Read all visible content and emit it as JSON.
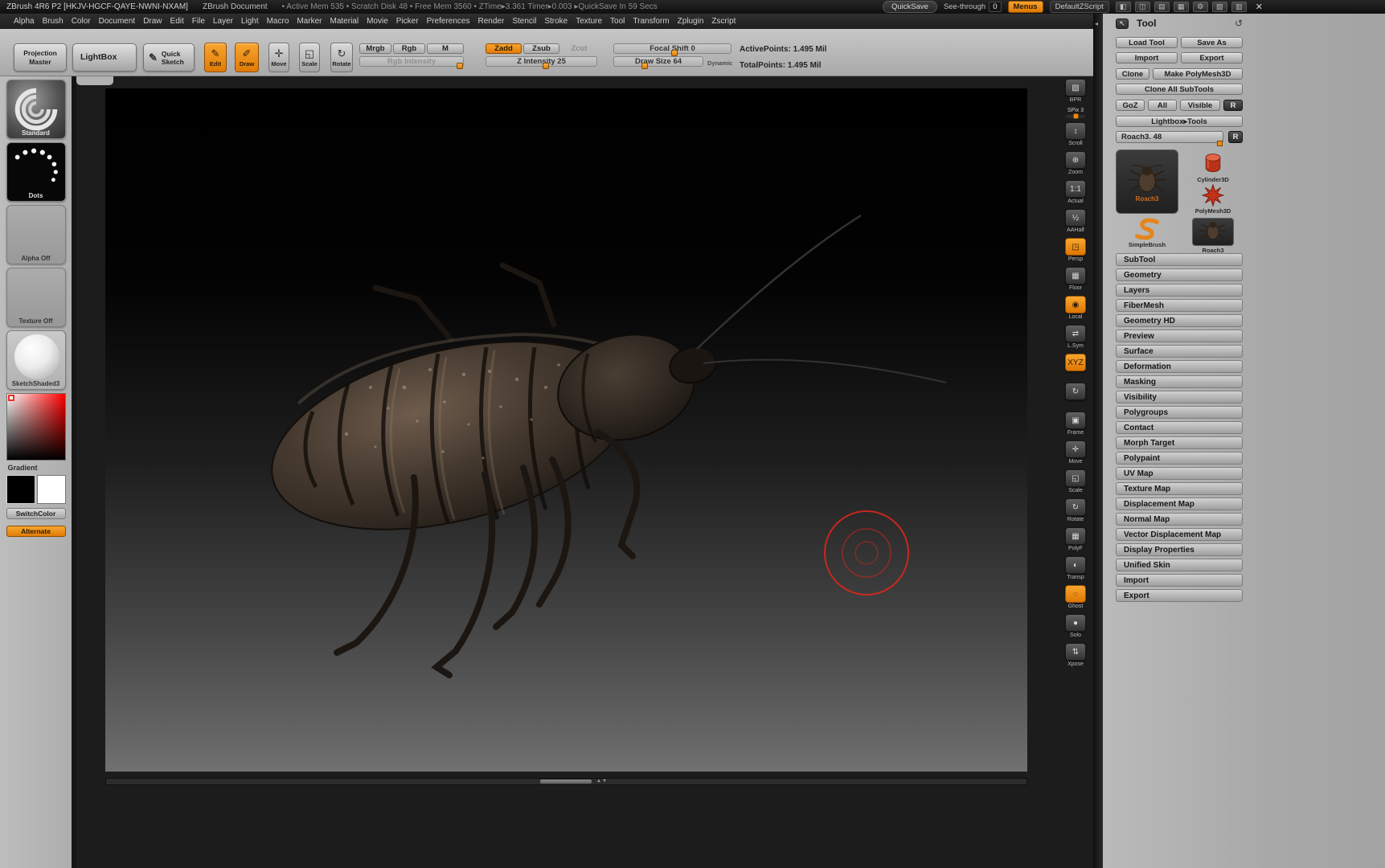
{
  "colors": {
    "accent": "#ed8a0e",
    "ui_gray": "#b5b5b5",
    "canvas_dark": "#1c1c1c"
  },
  "title_bar": {
    "app_title": "ZBrush 4R6 P2 [HKJV-HGCF-QAYE-NWNI-NXAM]",
    "document_title": "ZBrush Document",
    "stats": "• Active Mem 535  • Scratch Disk 48  • Free Mem 3560  • ZTime▸3.361  Timer▸0.003  ▸QuickSave In 59 Secs",
    "quicksave_label": "QuickSave",
    "see_through_label": "See-through",
    "see_through_value": "0",
    "menus_label": "Menus",
    "zscript_label": "DefaultZScript",
    "window_icons": [
      "◧",
      "◫",
      "▤",
      "▦",
      "⚙",
      "▧",
      "▥"
    ],
    "close_icon": "✕"
  },
  "menu_bar": {
    "items": [
      "Alpha",
      "Brush",
      "Color",
      "Document",
      "Draw",
      "Edit",
      "File",
      "Layer",
      "Light",
      "Macro",
      "Marker",
      "Material",
      "Movie",
      "Picker",
      "Preferences",
      "Render",
      "Stencil",
      "Stroke",
      "Texture",
      "Tool",
      "Transform",
      "Zplugin",
      "Zscript"
    ]
  },
  "top_shelf": {
    "projection_master": "Projection Master",
    "lightbox": "LightBox",
    "quick_sketch": "Quick Sketch",
    "quick_sketch_icon": "✎",
    "edit": "Edit",
    "edit_icon": "✎",
    "draw": "Draw",
    "draw_icon": "✐",
    "move": "Move",
    "move_icon": "✛",
    "scale": "Scale",
    "scale_icon": "◱",
    "rotate": "Rotate",
    "rotate_icon": "↻",
    "mrgb": "Mrgb",
    "rgb": "Rgb",
    "m": "M",
    "zadd": "Zadd",
    "zsub": "Zsub",
    "zcut": "Zcut",
    "rgb_intensity_label": "Rgb Intensity",
    "z_intensity_label": "Z Intensity 25",
    "focal_shift_label": "Focal Shift 0",
    "draw_size_label": "Draw Size 64",
    "dynamic_label": "Dynamic",
    "active_points": "ActivePoints: 1.495 Mil",
    "total_points": "TotalPoints: 1.495 Mil"
  },
  "left_tray": {
    "brush_label": "Standard",
    "stroke_label": "Dots",
    "alpha_label": "Alpha  Off",
    "texture_label": "Texture  Off",
    "material_label": "SketchShaded3",
    "gradient_label": "Gradient",
    "switch_color": "SwitchColor",
    "alternate": "Alternate"
  },
  "canvas": {
    "scroll_arrows": "▲▼"
  },
  "chrome": {
    "divider_arrow": "◂"
  },
  "right_shelf": {
    "bpr": {
      "label": "BPR",
      "icon": "▧"
    },
    "spix_label": "SPix 3",
    "items": [
      {
        "label": "Scroll",
        "icon": "↕"
      },
      {
        "label": "Zoom",
        "icon": "⊕"
      },
      {
        "label": "Actual",
        "icon": "1:1"
      },
      {
        "label": "AAHalf",
        "icon": "½"
      },
      {
        "label": "Persp",
        "icon": "◳",
        "active": true
      },
      {
        "label": "Floor",
        "icon": "▦"
      },
      {
        "label": "Local",
        "icon": "◉",
        "active": true
      },
      {
        "label": "L.Sym",
        "icon": "⇄"
      },
      {
        "label": "",
        "icon": "XYZ",
        "active": true
      },
      {
        "label": "",
        "icon": "↻"
      },
      {
        "label": "Frame",
        "icon": "▣"
      },
      {
        "label": "Move",
        "icon": "✛"
      },
      {
        "label": "Scale",
        "icon": "◱"
      },
      {
        "label": "Rotate",
        "icon": "↻"
      },
      {
        "label": "PolyF",
        "icon": "▦"
      },
      {
        "label": "Transp",
        "icon": "◐"
      },
      {
        "label": "Ghost",
        "icon": "◌",
        "active": true
      },
      {
        "label": "Solo",
        "icon": "●"
      },
      {
        "label": "Xpose",
        "icon": "⇅"
      }
    ]
  },
  "tool_palette": {
    "title": "Tool",
    "dock_icon": "↖",
    "refresh_icon": "↺",
    "load_tool": "Load Tool",
    "save_as": "Save As",
    "import_btn": "Import",
    "export_btn": "Export",
    "clone": "Clone",
    "make_polymesh3d": "Make PolyMesh3D",
    "clone_all_subtools": "Clone All SubTools",
    "goz": "GoZ",
    "all": "All",
    "visible": "Visible",
    "r": "R",
    "lightbox_tools": "Lightbox▸Tools",
    "current_tool": "Roach3. 48",
    "current_r": "R",
    "thumbs": {
      "active_label": "Roach3",
      "cylinder_label": "Cylinder3D",
      "polymesh_label": "PolyMesh3D",
      "simplebrush_label": "SimpleBrush",
      "recent_label": "Roach3"
    },
    "sections": [
      "SubTool",
      "Geometry",
      "Layers",
      "FiberMesh",
      "Geometry HD",
      "Preview",
      "Surface",
      "Deformation",
      "Masking",
      "Visibility",
      "Polygroups",
      "Contact",
      "Morph Target",
      "Polypaint",
      "UV Map",
      "Texture Map",
      "Displacement Map",
      "Normal Map",
      "Vector Displacement Map",
      "Display Properties",
      "Unified Skin",
      "Import",
      "Export"
    ]
  }
}
